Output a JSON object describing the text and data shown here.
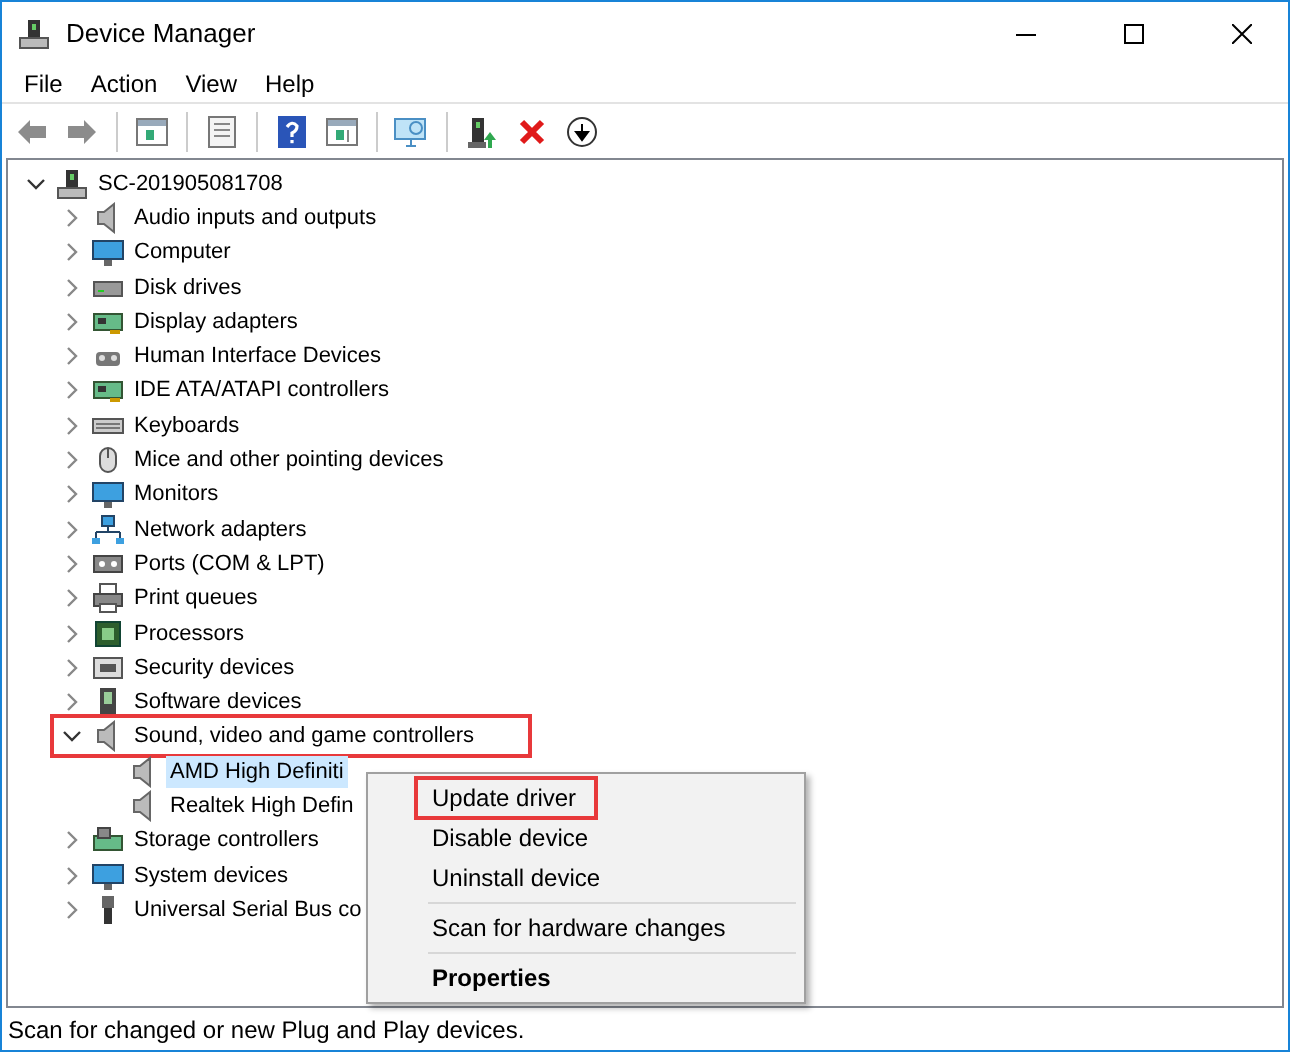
{
  "window": {
    "title": "Device Manager"
  },
  "menu_bar": [
    "File",
    "Action",
    "View",
    "Help"
  ],
  "tree": {
    "label": "SC-201905081708",
    "expanded": true,
    "selected": false,
    "highlighted": false,
    "children": [
      {
        "label": "Audio inputs and outputs",
        "expanded": false,
        "selected": false,
        "highlighted": false
      },
      {
        "label": "Computer",
        "expanded": false,
        "selected": false,
        "highlighted": false
      },
      {
        "label": "Disk drives",
        "expanded": false,
        "selected": false,
        "highlighted": false
      },
      {
        "label": "Display adapters",
        "expanded": false,
        "selected": false,
        "highlighted": false
      },
      {
        "label": "Human Interface Devices",
        "expanded": false,
        "selected": false,
        "highlighted": false
      },
      {
        "label": "IDE ATA/ATAPI controllers",
        "expanded": false,
        "selected": false,
        "highlighted": false
      },
      {
        "label": "Keyboards",
        "expanded": false,
        "selected": false,
        "highlighted": false
      },
      {
        "label": "Mice and other pointing devices",
        "expanded": false,
        "selected": false,
        "highlighted": false
      },
      {
        "label": "Monitors",
        "expanded": false,
        "selected": false,
        "highlighted": false
      },
      {
        "label": "Network adapters",
        "expanded": false,
        "selected": false,
        "highlighted": false
      },
      {
        "label": "Ports (COM & LPT)",
        "expanded": false,
        "selected": false,
        "highlighted": false
      },
      {
        "label": "Print queues",
        "expanded": false,
        "selected": false,
        "highlighted": false
      },
      {
        "label": "Processors",
        "expanded": false,
        "selected": false,
        "highlighted": false
      },
      {
        "label": "Security devices",
        "expanded": false,
        "selected": false,
        "highlighted": false
      },
      {
        "label": "Software devices",
        "expanded": false,
        "selected": false,
        "highlighted": false
      },
      {
        "label": "Sound, video and game controllers",
        "expanded": true,
        "selected": false,
        "highlighted": true,
        "children": [
          {
            "label": "AMD High Definiti",
            "selected": true,
            "highlighted": false
          },
          {
            "label": "Realtek High Defin",
            "selected": false,
            "highlighted": false
          }
        ]
      },
      {
        "label": "Storage controllers",
        "expanded": false,
        "selected": false,
        "highlighted": false
      },
      {
        "label": "System devices",
        "expanded": false,
        "selected": false,
        "highlighted": false
      },
      {
        "label": "Universal Serial Bus co",
        "expanded": false,
        "selected": false,
        "highlighted": false
      }
    ]
  },
  "context_menu": [
    {
      "kind": "item",
      "label": "Update driver",
      "highlighted": true,
      "default": false
    },
    {
      "kind": "item",
      "label": "Disable device",
      "highlighted": false,
      "default": false
    },
    {
      "kind": "item",
      "label": "Uninstall device",
      "highlighted": false,
      "default": false
    },
    {
      "kind": "separator"
    },
    {
      "kind": "item",
      "label": "Scan for hardware changes",
      "highlighted": false,
      "default": false
    },
    {
      "kind": "separator"
    },
    {
      "kind": "item",
      "label": "Properties",
      "highlighted": false,
      "default": true
    }
  ],
  "status_bar": "Scan for changed or new Plug and Play devices."
}
